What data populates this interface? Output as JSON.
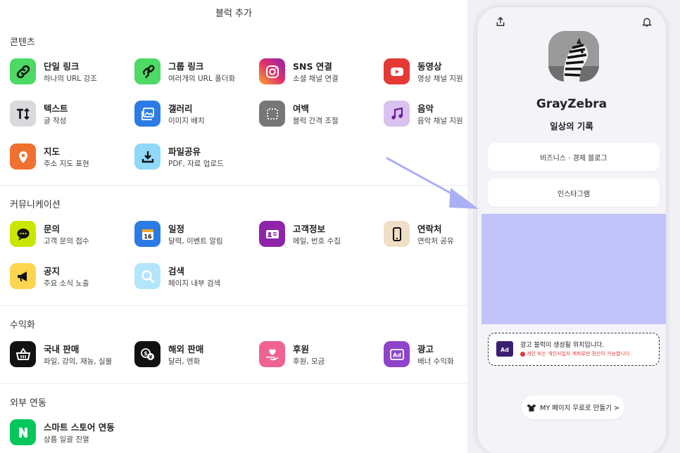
{
  "panel": {
    "title": "블럭 추가"
  },
  "sections": [
    {
      "title": "콘텐츠",
      "items": [
        {
          "label": "단일 링크",
          "desc": "하나의 URL 강조",
          "icon": "link-icon",
          "color": "#4cd964"
        },
        {
          "label": "그룹 링크",
          "desc": "여러개의 URL 폴더화",
          "icon": "group-link-icon",
          "color": "#4cd964"
        },
        {
          "label": "SNS 연결",
          "desc": "소셜 채널 연결",
          "icon": "instagram-icon",
          "color": "#e1306c"
        },
        {
          "label": "동영상",
          "desc": "영상 채널 지원",
          "icon": "youtube-icon",
          "color": "#e53935"
        },
        {
          "label": "텍스트",
          "desc": "글 작성",
          "icon": "text-icon",
          "color": "#d9d9de"
        },
        {
          "label": "갤러리",
          "desc": "이미지 배치",
          "icon": "gallery-icon",
          "color": "#2c7be5"
        },
        {
          "label": "여백",
          "desc": "블럭 간격 조절",
          "icon": "spacing-icon",
          "color": "#777777"
        },
        {
          "label": "음악",
          "desc": "음악 채널 지원",
          "icon": "music-icon",
          "color": "#d9c2f0"
        },
        {
          "label": "지도",
          "desc": "주소 지도 표현",
          "icon": "map-pin-icon",
          "color": "#f07030"
        },
        {
          "label": "파일공유",
          "desc": "PDF, 자료 업로드",
          "icon": "download-icon",
          "color": "#8ed8f8"
        }
      ]
    },
    {
      "title": "커뮤니케이션",
      "items": [
        {
          "label": "문의",
          "desc": "고객 문의 접수",
          "icon": "chat-icon",
          "color": "#c8e600"
        },
        {
          "label": "일정",
          "desc": "달력, 이벤트 알림",
          "icon": "calendar-icon",
          "color": "#2c7be5"
        },
        {
          "label": "고객정보",
          "desc": "메일, 번호 수집",
          "icon": "contact-card-icon",
          "color": "#8e24aa"
        },
        {
          "label": "연락처",
          "desc": "연락처 공유",
          "icon": "phone-icon",
          "color": "#efdfc6"
        },
        {
          "label": "공지",
          "desc": "주요 소식 노출",
          "icon": "megaphone-icon",
          "color": "#ffd54f"
        },
        {
          "label": "검색",
          "desc": "페이지 내부 검색",
          "icon": "search-icon",
          "color": "#b3e5fc"
        }
      ]
    },
    {
      "title": "수익화",
      "items": [
        {
          "label": "국내 판매",
          "desc": "파일, 강의, 재능, 실물",
          "icon": "basket-icon",
          "color": "#111111"
        },
        {
          "label": "해외 판매",
          "desc": "달러, 엔화",
          "icon": "currency-icon",
          "color": "#111111"
        },
        {
          "label": "후원",
          "desc": "후원, 모금",
          "icon": "heart-hand-icon",
          "color": "#f06292"
        },
        {
          "label": "광고",
          "desc": "배너 수익화",
          "icon": "ad-icon",
          "color": "#8e44c8"
        }
      ]
    },
    {
      "title": "외부 연동",
      "items": [
        {
          "label": "스마트 스토어 연동",
          "desc": "상품 일괄 진열",
          "icon": "naver-icon",
          "color": "#03c75a"
        }
      ]
    }
  ],
  "preview": {
    "name": "GrayZebra",
    "bio": "일상의 기록",
    "links": [
      "비즈니스 · 경제 블로그",
      "인스타그램"
    ],
    "ad_note": {
      "line1": "광고 블럭이 생성될 위치입니다.",
      "line2": "개인 또는 개인사업자 계좌로만 정산이 가능합니다."
    },
    "my_page_button": "MY 페이지 무료로 만들기 >",
    "ad_zone_color": "#c3c3fb"
  }
}
